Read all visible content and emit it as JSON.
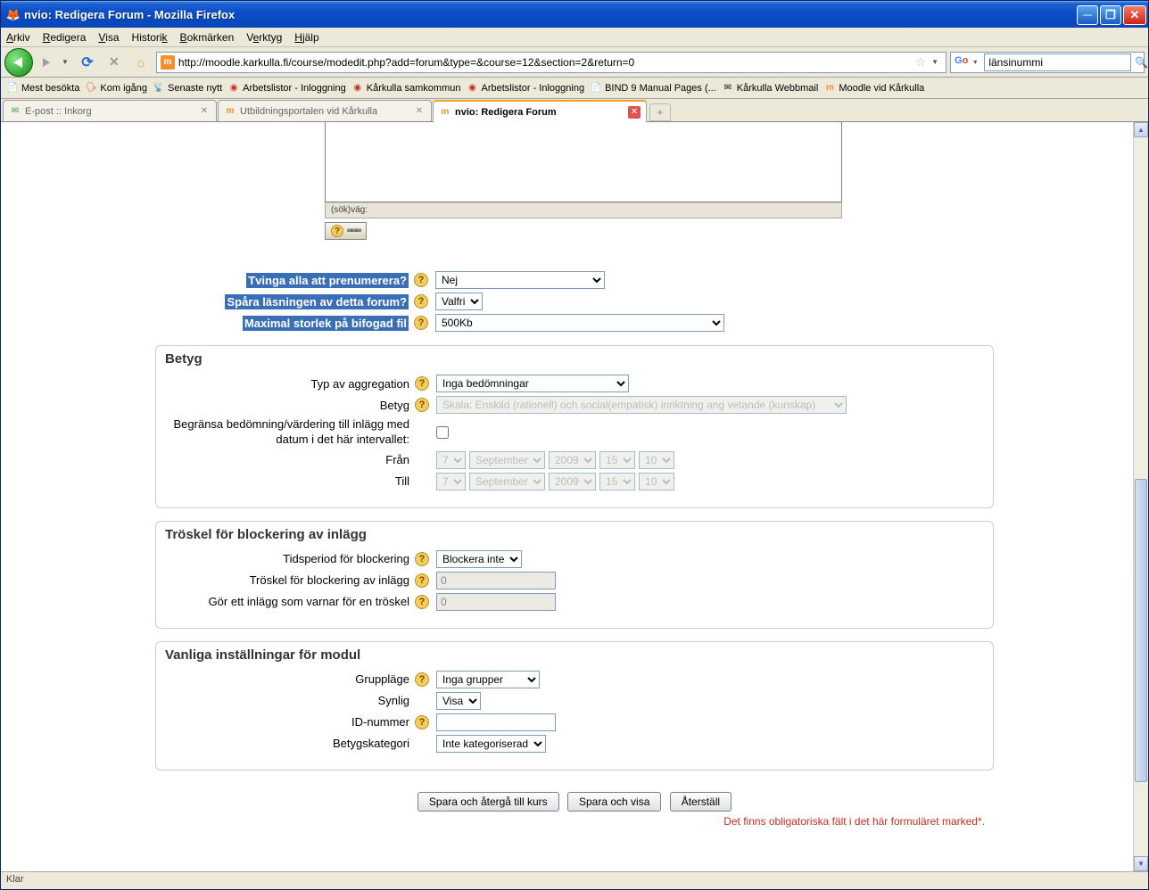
{
  "window": {
    "title": "nvio: Redigera Forum - Mozilla Firefox"
  },
  "menubar": {
    "arkiv": "Arkiv",
    "redigera": "Redigera",
    "visa": "Visa",
    "historik": "Historik",
    "bokmarken": "Bokmärken",
    "verktyg": "Verktyg",
    "hjalp": "Hjälp"
  },
  "url": "http://moodle.karkulla.fi/course/modedit.php?add=forum&type=&course=12&section=2&return=0",
  "search": {
    "placeholder": "",
    "value": "länsinummi"
  },
  "bookmarks": {
    "mest": "Mest besökta",
    "kom": "Kom igång",
    "senaste": "Senaste nytt",
    "arb1": "Arbetslistor - Inloggning",
    "samkommun": "Kårkulla samkommun",
    "arb2": "Arbetslistor - Inloggning",
    "bind9": "BIND 9 Manual Pages (...",
    "webbmail": "Kårkulla Webbmail",
    "moodle": "Moodle vid Kårkulla"
  },
  "tabs": {
    "t1": "E-post :: Inkorg",
    "t2": "Utbildningsportalen vid Kårkulla",
    "t3": "nvio: Redigera Forum"
  },
  "editor": {
    "status": "(sök)väg:",
    "toggle": "⌨⌨⌨"
  },
  "section1": {
    "subscribe_label": "Tvinga alla att prenumerera?",
    "subscribe_value": "Nej",
    "track_label": "Spåra läsningen av detta forum?",
    "track_value": "Valfri",
    "maxsize_label": "Maximal storlek på bifogad fil",
    "maxsize_value": "500Kb"
  },
  "grades": {
    "legend": "Betyg",
    "aggtype_label": "Typ av aggregation",
    "aggtype_value": "Inga bedömningar",
    "grade_label": "Betyg",
    "grade_value": "Skala: Enskild (rationell) och social(empatisk) inriktning ang vetande (kunskap)",
    "restrict_label": "Begränsa bedömning/värdering till inlägg med datum i det här intervallet:",
    "from_label": "Från",
    "to_label": "Till",
    "day": "7",
    "month": "September",
    "year": "2009",
    "hour": "15",
    "min": "10"
  },
  "block": {
    "legend": "Tröskel för blockering av inlägg",
    "period_label": "Tidsperiod för blockering",
    "period_value": "Blockera inte",
    "threshold_label": "Tröskel för blockering av inlägg",
    "threshold_value": "0",
    "warn_label": "Gör ett inlägg som varnar för en tröskel",
    "warn_value": "0"
  },
  "common": {
    "legend": "Vanliga inställningar för modul",
    "groupmode_label": "Gruppläge",
    "groupmode_value": "Inga grupper",
    "visible_label": "Synlig",
    "visible_value": "Visa",
    "id_label": "ID-nummer",
    "id_value": "",
    "gradecat_label": "Betygskategori",
    "gradecat_value": "Inte kategoriserad"
  },
  "buttons": {
    "save_return": "Spara och återgå till kurs",
    "save_show": "Spara och visa",
    "cancel": "Återställ"
  },
  "required_note": "Det finns obligatoriska fält i det här formuläret marked*.",
  "status": "Klar"
}
